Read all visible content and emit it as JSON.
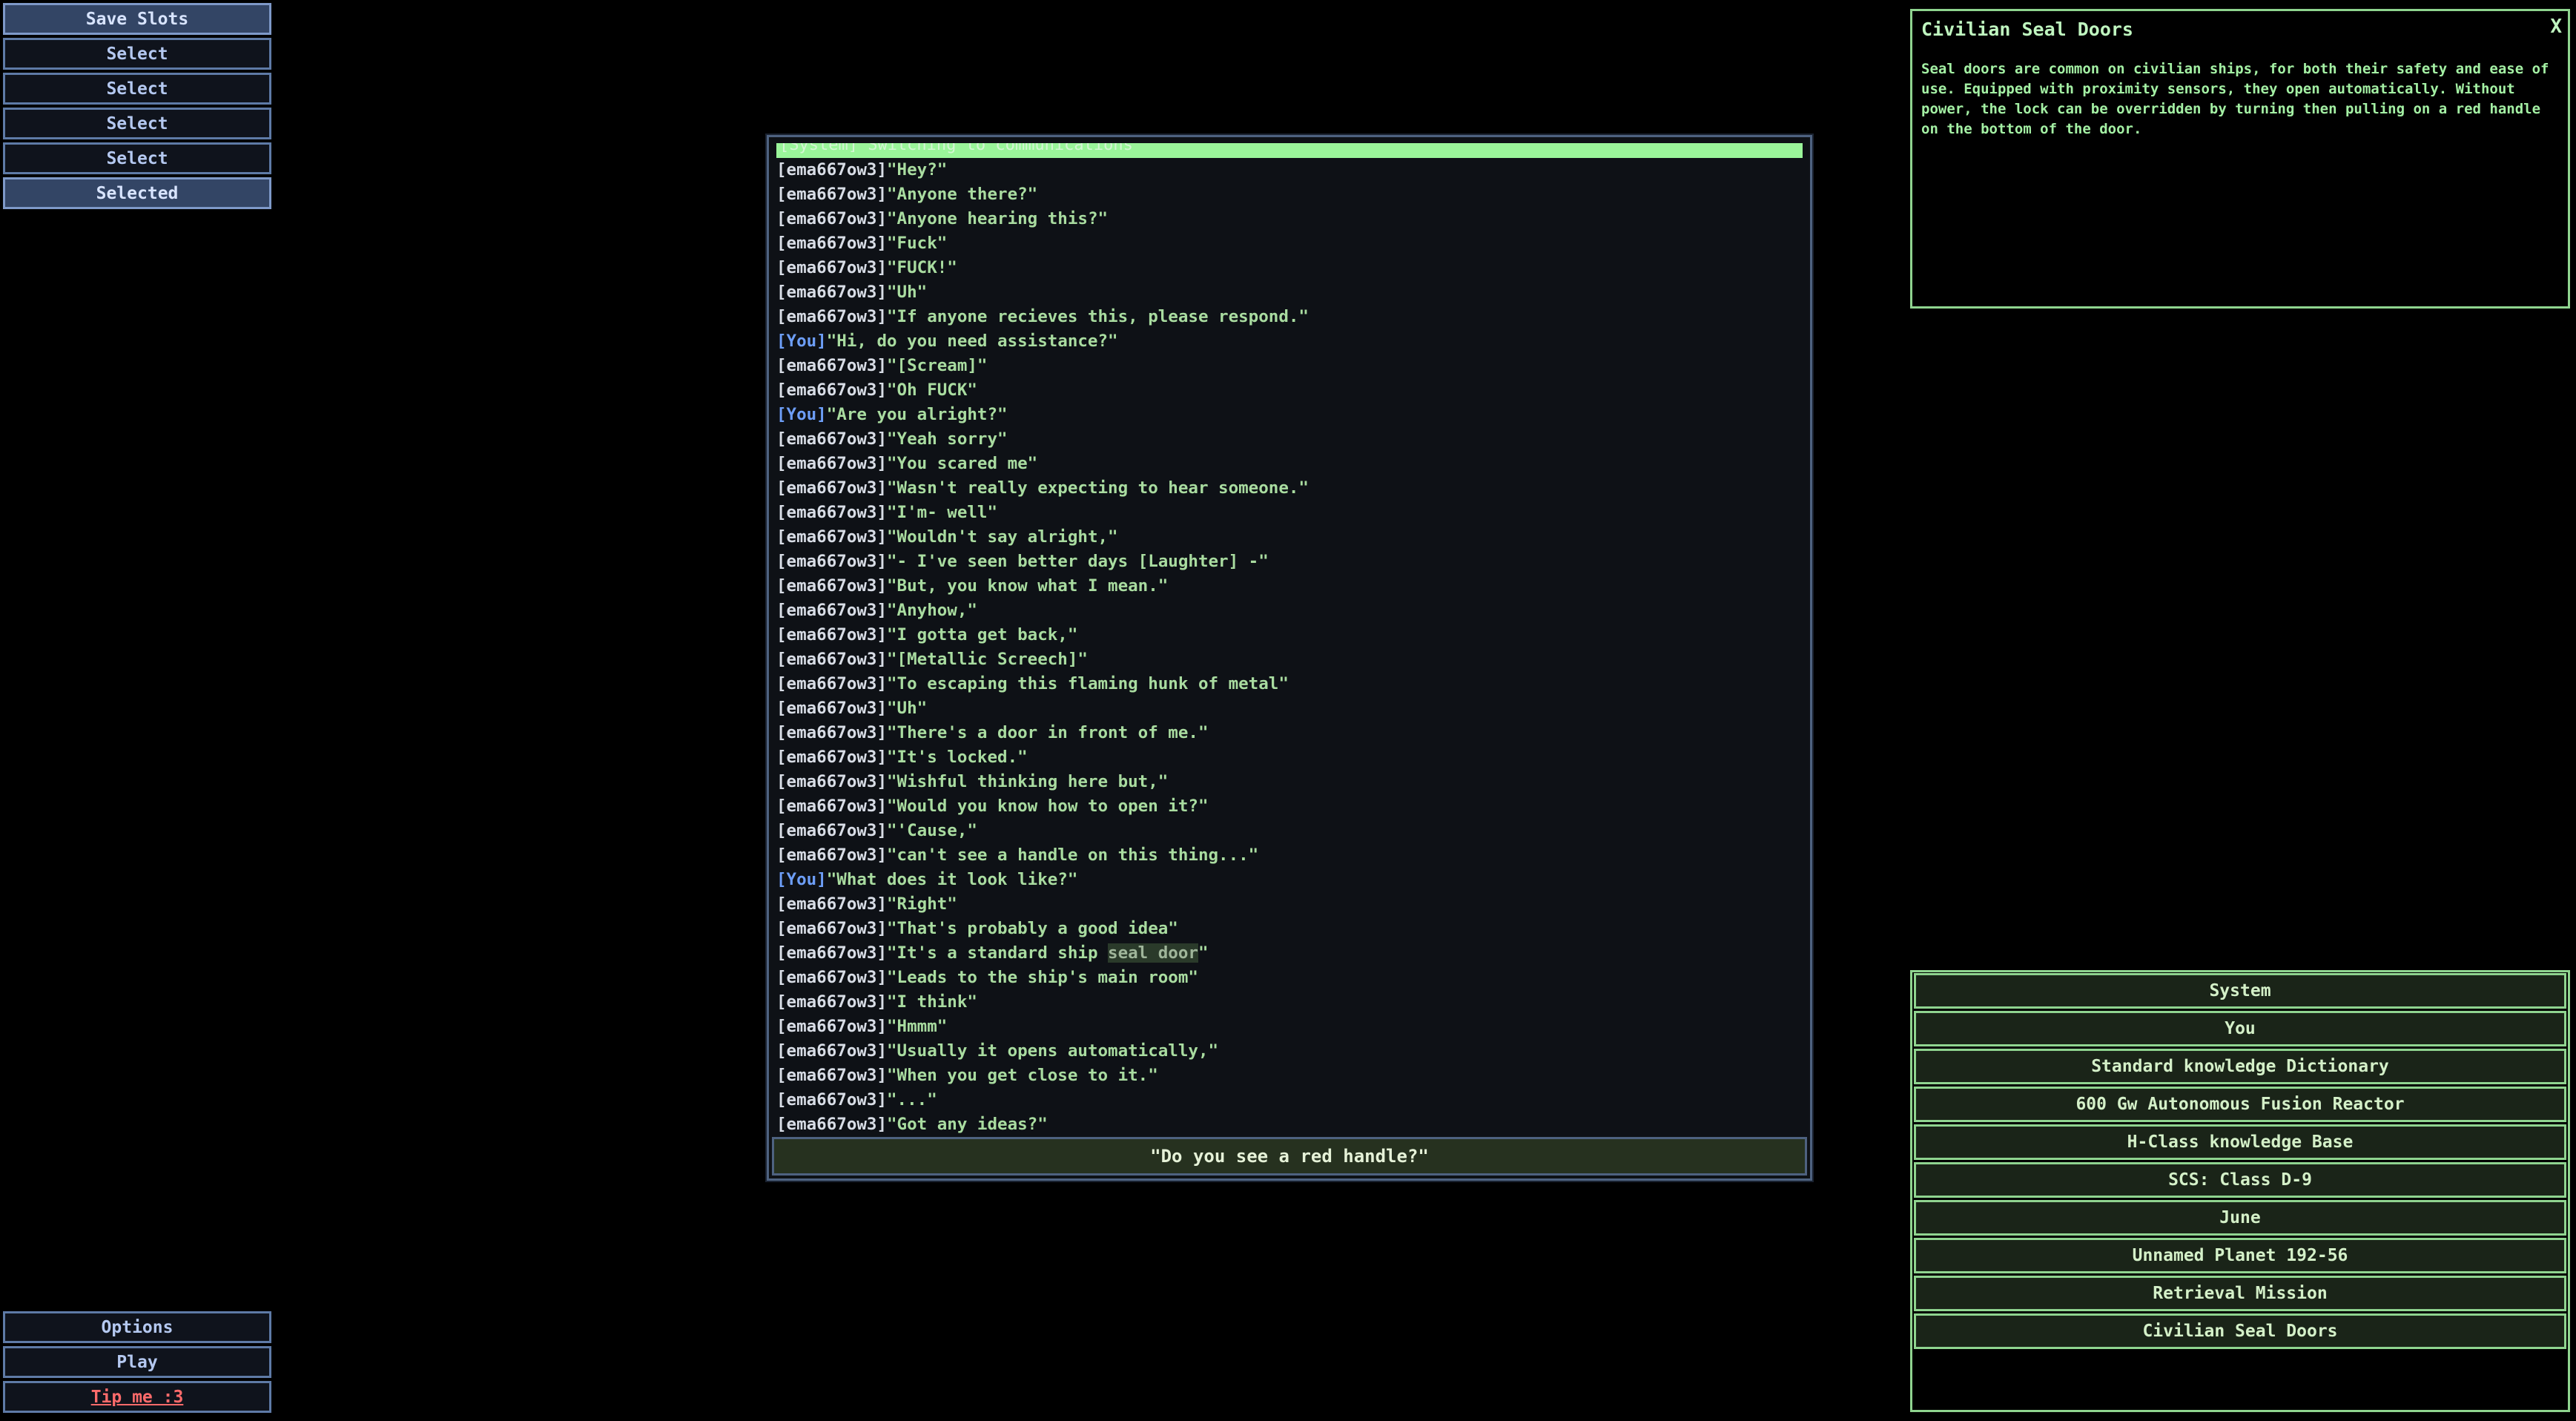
{
  "save_slots": {
    "header": "Save Slots",
    "slots": [
      "Select",
      "Select",
      "Select",
      "Select",
      "Selected"
    ]
  },
  "bottom_menu": {
    "options": "Options",
    "play": "Play",
    "tip": "Tip me :3"
  },
  "chat": {
    "system_line": "[System] Switching to communications",
    "messages": [
      {
        "speaker": "[ema667ow3]",
        "text": "\"Hey?\""
      },
      {
        "speaker": "[ema667ow3]",
        "text": "\"Anyone there?\""
      },
      {
        "speaker": "[ema667ow3]",
        "text": "\"Anyone hearing this?\""
      },
      {
        "speaker": "[ema667ow3]",
        "text": "\"Fuck\""
      },
      {
        "speaker": "[ema667ow3]",
        "text": "\"FUCK!\""
      },
      {
        "speaker": "[ema667ow3]",
        "text": "\"Uh\""
      },
      {
        "speaker": "[ema667ow3]",
        "text": "\"If anyone recieves this, please respond.\""
      },
      {
        "speaker": "[You]",
        "text": "\"Hi, do you need assistance?\""
      },
      {
        "speaker": "[ema667ow3]",
        "text": "\"[Scream]\""
      },
      {
        "speaker": "[ema667ow3]",
        "text": "\"Oh FUCK\""
      },
      {
        "speaker": "[You]",
        "text": "\"Are you alright?\""
      },
      {
        "speaker": "[ema667ow3]",
        "text": "\"Yeah sorry\""
      },
      {
        "speaker": "[ema667ow3]",
        "text": "\"You scared me\""
      },
      {
        "speaker": "[ema667ow3]",
        "text": "\"Wasn't really expecting to hear someone.\""
      },
      {
        "speaker": "[ema667ow3]",
        "text": "\"I'm- well\""
      },
      {
        "speaker": "[ema667ow3]",
        "text": "\"Wouldn't say alright,\""
      },
      {
        "speaker": "[ema667ow3]",
        "text": "\"- I've seen better days [Laughter] -\""
      },
      {
        "speaker": "[ema667ow3]",
        "text": "\"But, you know what I mean.\""
      },
      {
        "speaker": "[ema667ow3]",
        "text": "\"Anyhow,\""
      },
      {
        "speaker": "[ema667ow3]",
        "text": "\"I gotta get back,\""
      },
      {
        "speaker": "[ema667ow3]",
        "text": "\"[Metallic Screech]\""
      },
      {
        "speaker": "[ema667ow3]",
        "text": "\"To escaping this flaming hunk of metal\""
      },
      {
        "speaker": "[ema667ow3]",
        "text": "\"Uh\""
      },
      {
        "speaker": "[ema667ow3]",
        "text": "\"There's a door in front of me.\""
      },
      {
        "speaker": "[ema667ow3]",
        "text": "\"It's locked.\""
      },
      {
        "speaker": "[ema667ow3]",
        "text": "\"Wishful thinking here but,\""
      },
      {
        "speaker": "[ema667ow3]",
        "text": "\"Would you know how to open it?\""
      },
      {
        "speaker": "[ema667ow3]",
        "text": "\"'Cause,\""
      },
      {
        "speaker": "[ema667ow3]",
        "text": "\"can't see a handle on this thing...\""
      },
      {
        "speaker": "[You]",
        "text": "\"What does it look like?\""
      },
      {
        "speaker": "[ema667ow3]",
        "text": "\"Right\""
      },
      {
        "speaker": "[ema667ow3]",
        "text": "\"That's probably a good idea\""
      },
      {
        "speaker": "[ema667ow3]",
        "text": "\"It's a standard ship ",
        "highlight": "seal door",
        "after": "\""
      },
      {
        "speaker": "[ema667ow3]",
        "text": "\"Leads to the ship's main room\""
      },
      {
        "speaker": "[ema667ow3]",
        "text": "\"I think\""
      },
      {
        "speaker": "[ema667ow3]",
        "text": "\"Hmmm\""
      },
      {
        "speaker": "[ema667ow3]",
        "text": "\"Usually it opens automatically,\""
      },
      {
        "speaker": "[ema667ow3]",
        "text": "\"When you get close to it.\""
      },
      {
        "speaker": "[ema667ow3]",
        "text": "\"...\""
      },
      {
        "speaker": "[ema667ow3]",
        "text": "\"Got any ideas?\""
      }
    ],
    "response_option": "\"Do you see a red handle?\""
  },
  "info_panel": {
    "title": "Civilian Seal Doors",
    "close_label": "X",
    "body": "Seal doors are common on civilian ships, for both their safety and ease of use. Equipped with proximity sensors, they open automatically. Without power, the lock can be overridden by turning then pulling on a red handle on the bottom of the door."
  },
  "topics": [
    "System",
    "You",
    "Standard knowledge Dictionary",
    "600 Gw Autonomous Fusion Reactor",
    "H-Class knowledge Base",
    "SCS: Class D-9",
    "June",
    "Unnamed Planet 192-56",
    "Retrieval Mission",
    "Civilian Seal Doors"
  ],
  "colors": {
    "background": "#000000",
    "slot_border": "#5e7aa6",
    "chat_text": "#a9dca0",
    "you_speaker": "#6d9ef7",
    "panel_green": "#8fd48f",
    "tip_red": "#ff6b6b"
  }
}
